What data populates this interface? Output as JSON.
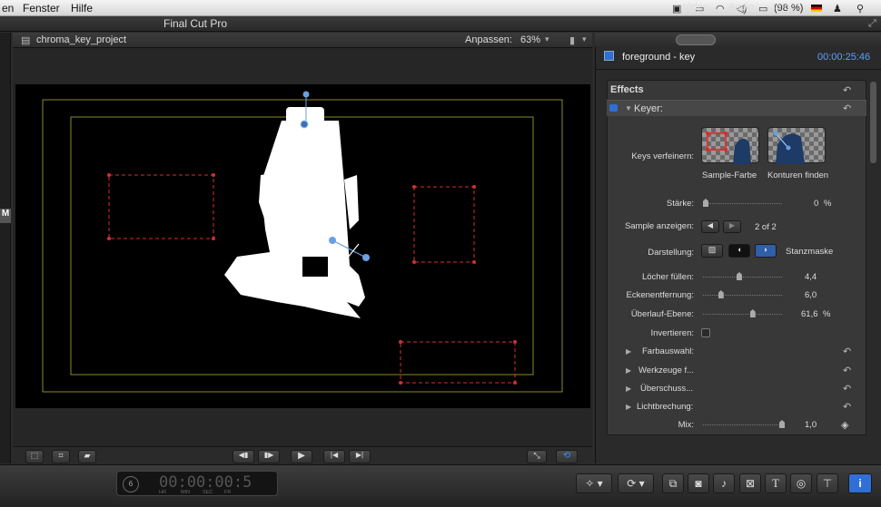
{
  "menubar": {
    "items": [
      "en",
      "Fenster",
      "Hilfe"
    ],
    "battery": "(98 %)"
  },
  "app": {
    "title": "Final Cut Pro"
  },
  "viewer": {
    "project": "chroma_key_project",
    "zoom_label": "Anpassen:",
    "zoom_value": "63%"
  },
  "inspector": {
    "tabs": [
      "Video",
      "Audio",
      "Info"
    ],
    "clip_name": "foreground - key",
    "timecode": "00:00:25:46",
    "effects_label": "Effects",
    "effect_name": "Keyer:",
    "keys_label": "Keys verfeinern:",
    "sample_color": "Sample-Farbe",
    "find_edges": "Konturen finden",
    "strength_label": "Stärke:",
    "strength_value": "0",
    "strength_unit": "%",
    "strength_level": 0,
    "sample_show_label": "Sample anzeigen:",
    "sample_count": "2 of 2",
    "display_label": "Darstellung:",
    "display_mode": "Stanzmaske",
    "fill_holes_label": "Löcher füllen:",
    "fill_holes_value": "4,4",
    "fill_holes_level": 0.44,
    "edge_dist_label": "Eckenentfernung:",
    "edge_dist_value": "6,0",
    "edge_dist_level": 0.2,
    "spill_label": "Überlauf-Ebene:",
    "spill_value": "61,6",
    "spill_unit": "%",
    "spill_level": 0.616,
    "invert_label": "Invertieren:",
    "groups": [
      "Farbauswahl:",
      "Werkzeuge f...",
      "Überschuss...",
      "Lichtbrechung:"
    ],
    "mix_label": "Mix:",
    "mix_value": "1,0",
    "mix_level": 1.0
  },
  "timecode_display": {
    "value": "00:00:00:5",
    "sub": [
      "HR",
      "MIN",
      "SEC",
      "FR"
    ],
    "counter": "6"
  },
  "colors": {
    "accent": "#2f6fd6",
    "timecode": "#5aa0ff",
    "key_box": "#d23030",
    "title_safe": "#8a8a2a"
  }
}
